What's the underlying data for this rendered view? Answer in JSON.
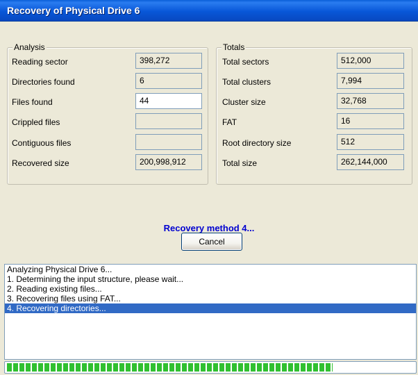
{
  "window": {
    "title": "Recovery of Physical Drive 6"
  },
  "analysis": {
    "title": "Analysis",
    "rows": [
      {
        "label": "Reading sector",
        "value": "398,272"
      },
      {
        "label": "Directories found",
        "value": "6"
      },
      {
        "label": "Files found",
        "value": "44"
      },
      {
        "label": "Crippled files",
        "value": ""
      },
      {
        "label": "Contiguous files",
        "value": ""
      },
      {
        "label": "Recovered size",
        "value": "200,998,912"
      }
    ]
  },
  "totals": {
    "title": "Totals",
    "rows": [
      {
        "label": "Total sectors",
        "value": "512,000"
      },
      {
        "label": "Total clusters",
        "value": "7,994"
      },
      {
        "label": "Cluster size",
        "value": "32,768"
      },
      {
        "label": "FAT",
        "value": "16"
      },
      {
        "label": "Root directory size",
        "value": "512"
      },
      {
        "label": "Total size",
        "value": "262,144,000"
      }
    ]
  },
  "status": {
    "text": "Recovery method 4..."
  },
  "buttons": {
    "cancel": "Cancel"
  },
  "log": {
    "lines": [
      "Analyzing Physical Drive 6...",
      "1. Determining the input structure, please wait...",
      "2. Reading existing files...",
      "3. Recovering files using FAT...",
      "4. Recovering directories..."
    ],
    "selected_index": 4
  },
  "progress": {
    "percent": 80
  },
  "colors": {
    "titlebar": "#0a5fd8",
    "status_text": "#0000d0",
    "selection": "#316ac5",
    "progress": "#30c030"
  }
}
